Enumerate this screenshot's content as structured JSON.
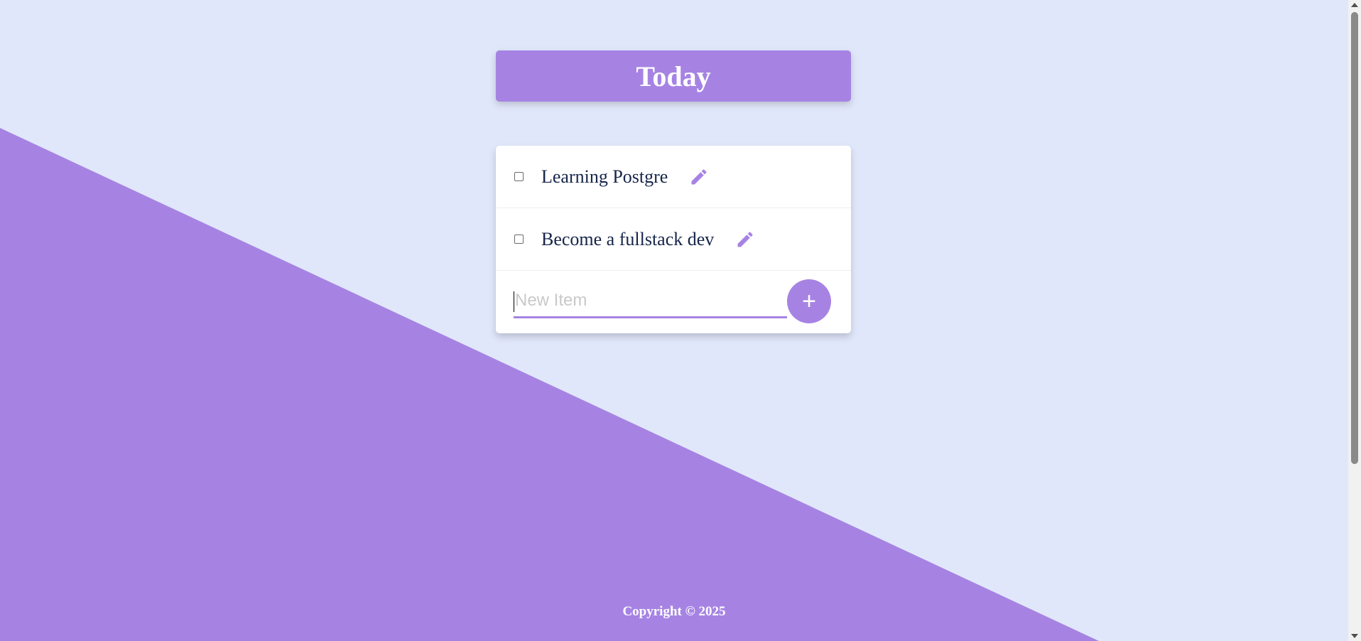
{
  "colors": {
    "accent": "#A683E3",
    "background": "#E1E7FB",
    "card": "#FFFFFF",
    "item_text": "#16254A"
  },
  "header": {
    "title": "Today"
  },
  "todo": {
    "items": [
      {
        "label": "Learning Postgre",
        "checked": false,
        "edit_icon": "pencil-icon"
      },
      {
        "label": "Become a fullstack dev",
        "checked": false,
        "edit_icon": "pencil-icon"
      }
    ],
    "new_item": {
      "value": "",
      "placeholder": "New Item"
    },
    "add_button": {
      "label": "+"
    }
  },
  "footer": {
    "copyright": "Copyright © 2025"
  }
}
